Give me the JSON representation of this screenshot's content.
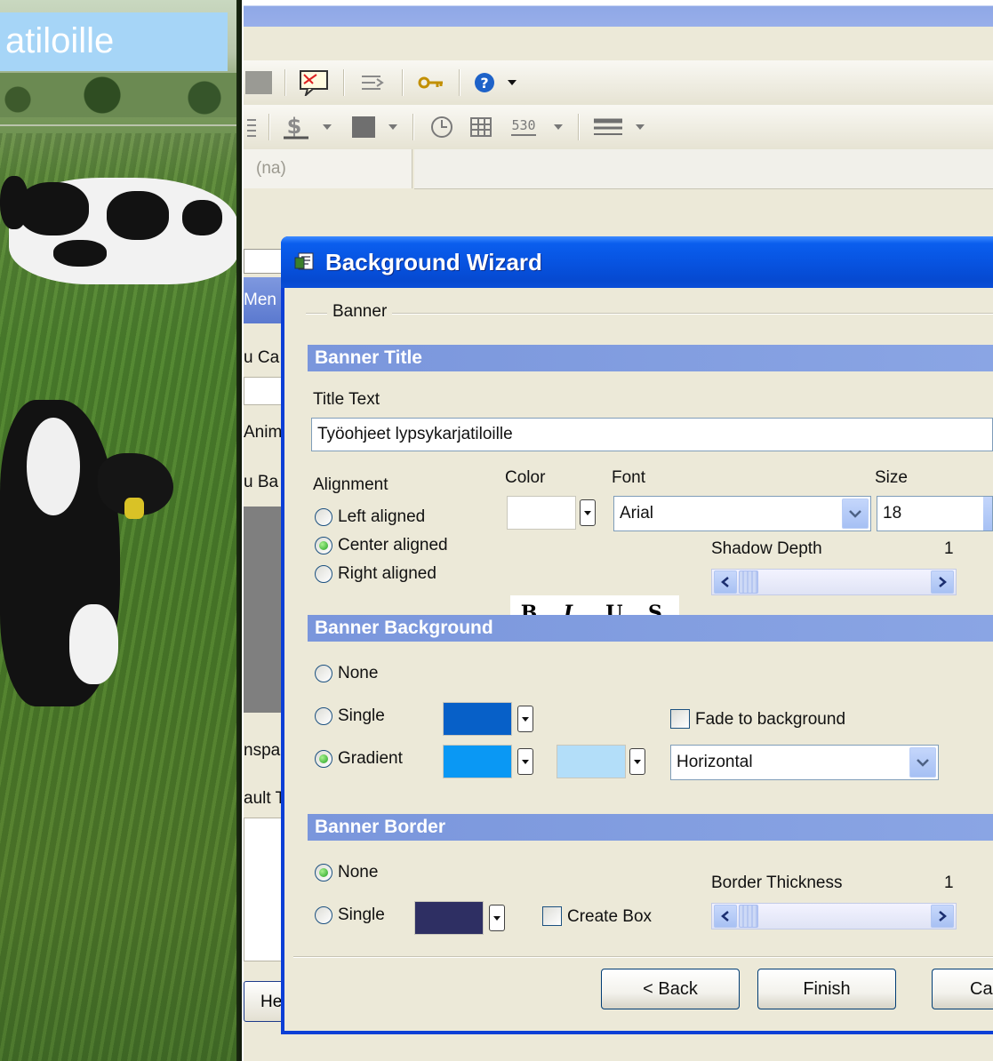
{
  "background_banner": {
    "text": "atiloille"
  },
  "app": {
    "field_placeholder": "(na)",
    "underlying_labels": [
      "Men",
      "u Ca",
      "Anim",
      "u Ba",
      "nspa",
      "ault T",
      "He"
    ]
  },
  "wizard": {
    "title": "Background Wizard",
    "group_label": "Banner",
    "banner_title": {
      "heading": "Banner Title",
      "title_text_label": "Title Text",
      "title_text_value": "Työohjeet lypsykarjatiloille",
      "alignment_label": "Alignment",
      "alignment_options": [
        "Left aligned",
        "Center aligned",
        "Right aligned"
      ],
      "alignment_selected": "Center aligned",
      "color_label": "Color",
      "font_label": "Font",
      "font_value": "Arial",
      "size_label": "Size",
      "size_value": "18",
      "style_buttons": [
        "B",
        "I",
        "U",
        "S"
      ],
      "shadow_depth_label": "Shadow Depth",
      "shadow_depth_value": "1"
    },
    "banner_background": {
      "heading": "Banner Background",
      "options": [
        "None",
        "Single",
        "Gradient"
      ],
      "selected": "Gradient",
      "single_color": "#0760c8",
      "gradient_color_1": "#0a98f4",
      "gradient_color_2": "#b3def9",
      "fade_label": "Fade to background",
      "fade_checked": false,
      "direction_value": "Horizontal"
    },
    "banner_border": {
      "heading": "Banner Border",
      "options": [
        "None",
        "Single"
      ],
      "selected": "None",
      "border_color": "#2e2f63",
      "create_box_label": "Create Box",
      "create_box_checked": false,
      "thickness_label": "Border Thickness",
      "thickness_value": "1"
    },
    "buttons": {
      "back": "< Back",
      "finish": "Finish",
      "cancel": "Ca"
    }
  },
  "colors": {
    "title_bar": "#0753e0",
    "section_header": "#7a96dc",
    "dialog_face": "#ece9d8",
    "preview_banner": "#a6d5f7"
  }
}
